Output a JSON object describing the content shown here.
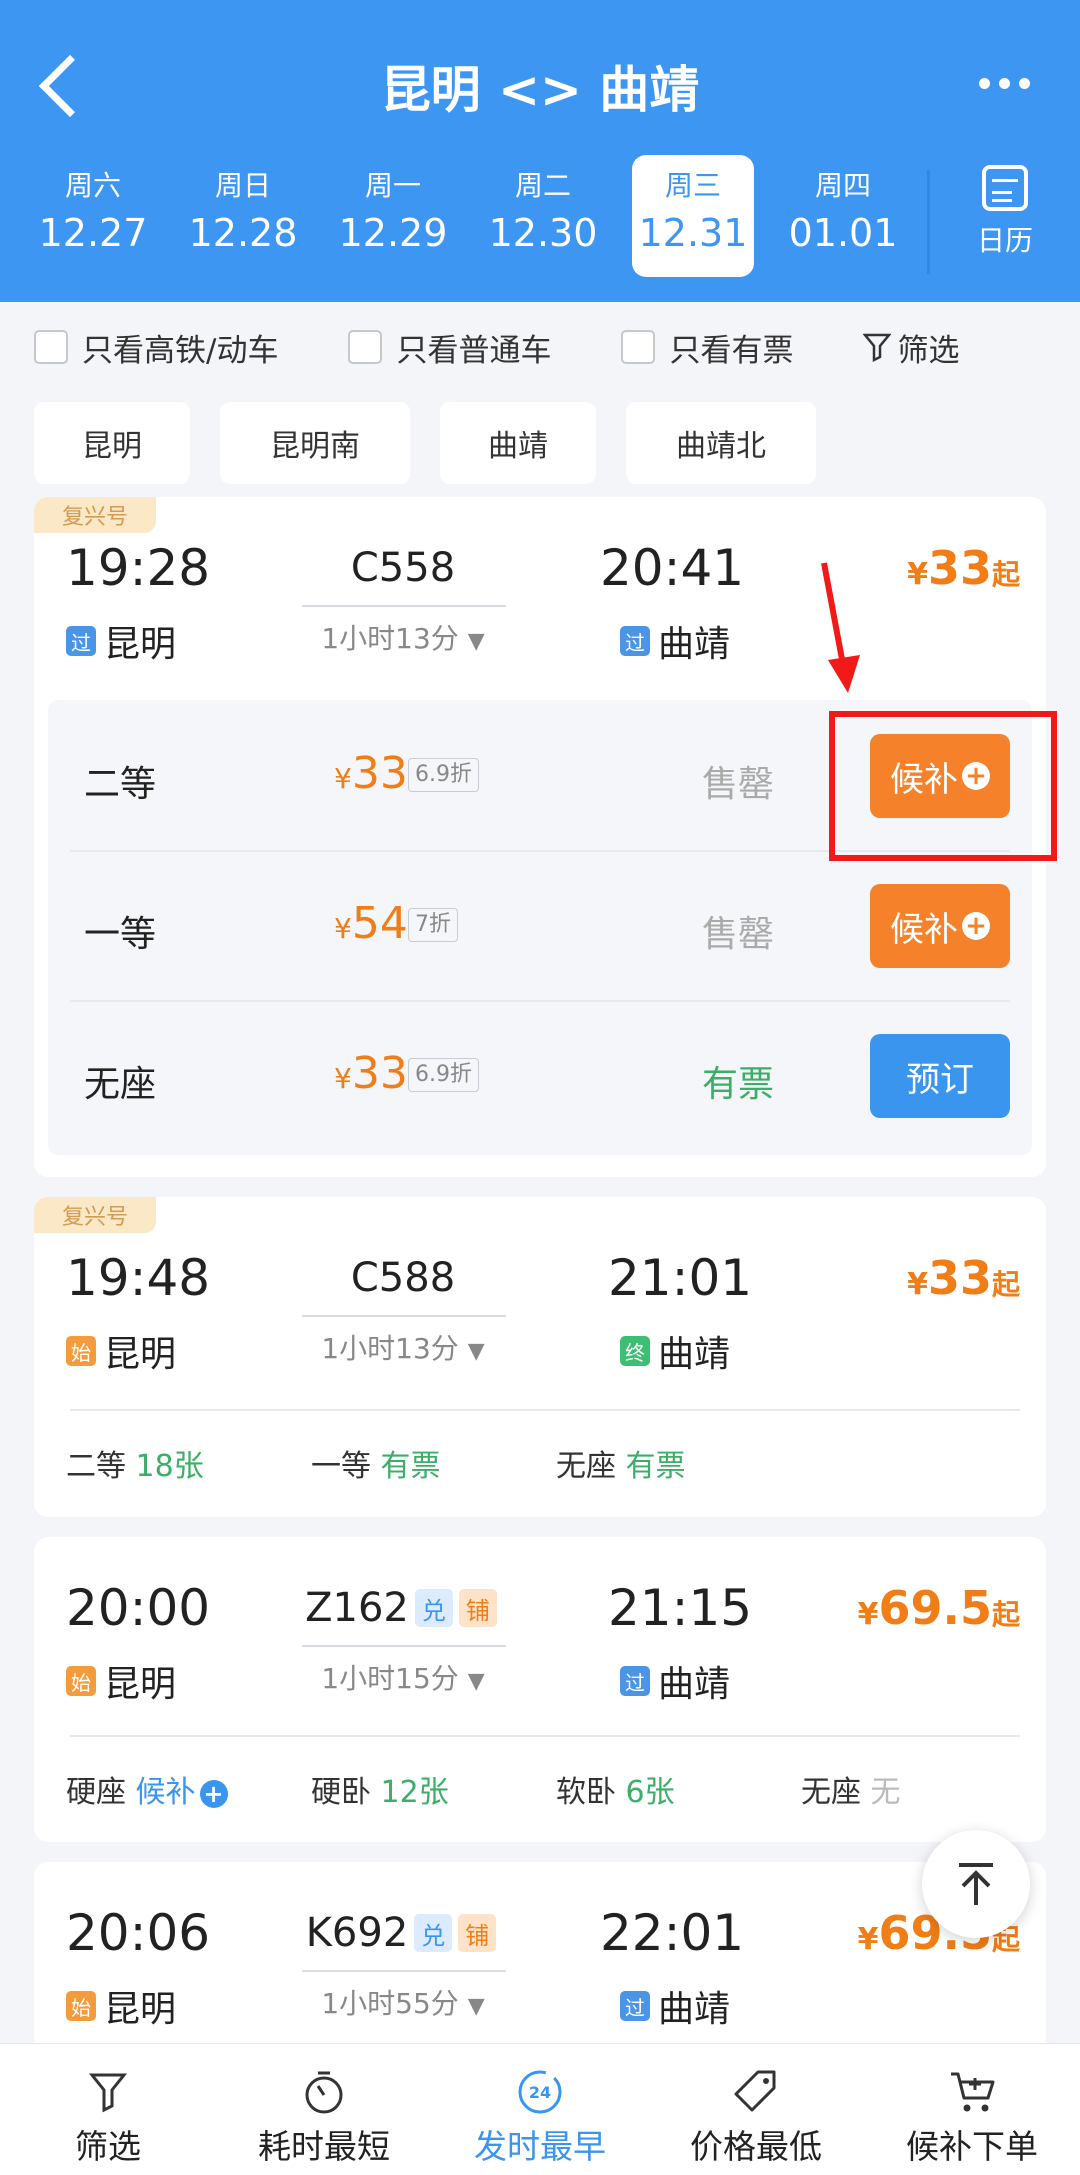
{
  "header": {
    "title": "昆明 <> 曲靖"
  },
  "dates": [
    {
      "weekday": "周六",
      "date": "12.27"
    },
    {
      "weekday": "周日",
      "date": "12.28"
    },
    {
      "weekday": "周一",
      "date": "12.29"
    },
    {
      "weekday": "周二",
      "date": "12.30"
    },
    {
      "weekday": "周三",
      "date": "12.31",
      "selected": true
    },
    {
      "weekday": "周四",
      "date": "01.01"
    }
  ],
  "calendar_label": "日历",
  "filters": {
    "gaotie": "只看高铁/动车",
    "putong": "只看普通车",
    "youpiao": "只看有票",
    "screen": "筛选"
  },
  "stations": [
    "昆明",
    "昆明南",
    "曲靖",
    "曲靖北"
  ],
  "trains": [
    {
      "tag": "复兴号",
      "dep_time": "19:28",
      "train_no": "C558",
      "duration": "1小时13分",
      "arr_time": "20:41",
      "dep_badge": "过",
      "dep_station": "昆明",
      "arr_badge": "过",
      "arr_station": "曲靖",
      "price_sym": "¥",
      "price": "33",
      "price_suffix": "起",
      "seats": [
        {
          "name": "二等",
          "price": "33",
          "discount": "6.9折",
          "status": "售罄",
          "button": "候补"
        },
        {
          "name": "一等",
          "price": "54",
          "discount": "7折",
          "status": "售罄",
          "button": "候补"
        },
        {
          "name": "无座",
          "price": "33",
          "discount": "6.9折",
          "status": "有票",
          "button": "预订"
        }
      ]
    },
    {
      "tag": "复兴号",
      "dep_time": "19:48",
      "train_no": "C588",
      "duration": "1小时13分",
      "arr_time": "21:01",
      "dep_badge": "始",
      "dep_station": "昆明",
      "arr_badge": "终",
      "arr_station": "曲靖",
      "price_sym": "¥",
      "price": "33",
      "price_suffix": "起",
      "summary": [
        {
          "name": "二等",
          "value": "18张"
        },
        {
          "name": "一等",
          "value": "有票"
        },
        {
          "name": "无座",
          "value": "有票"
        }
      ]
    },
    {
      "dep_time": "20:00",
      "train_no": "Z162",
      "tag_a": "兑",
      "tag_b": "铺",
      "duration": "1小时15分",
      "arr_time": "21:15",
      "dep_badge": "始",
      "dep_station": "昆明",
      "arr_badge": "过",
      "arr_station": "曲靖",
      "price_sym": "¥",
      "price": "69.5",
      "price_suffix": "起",
      "summary": [
        {
          "name": "硬座",
          "value": "候补"
        },
        {
          "name": "硬卧",
          "value": "12张"
        },
        {
          "name": "软卧",
          "value": "6张"
        },
        {
          "name": "无座",
          "value": "无"
        }
      ]
    },
    {
      "dep_time": "20:06",
      "train_no": "K692",
      "tag_a": "兑",
      "tag_b": "铺",
      "duration": "1小时55分",
      "arr_time": "22:01",
      "dep_badge": "始",
      "dep_station": "昆明",
      "arr_badge": "过",
      "arr_station": "曲靖",
      "price_sym": "¥",
      "price": "69.5",
      "price_suffix": "起"
    }
  ],
  "bottom_nav": [
    "筛选",
    "耗时最短",
    "发时最早",
    "价格最低",
    "候补下单"
  ],
  "bottom_nav_badge": "24",
  "colors": {
    "primary": "#3d96f2",
    "orange": "#f07d16",
    "green": "#3cae68",
    "highlight": "#f21919"
  }
}
